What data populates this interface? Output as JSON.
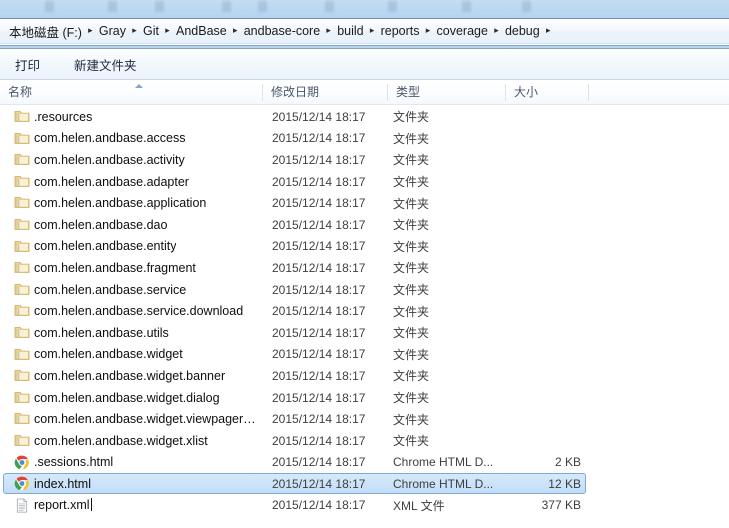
{
  "window": {
    "top_strip_label": ""
  },
  "addressbar": {
    "crumbs": [
      {
        "label": "本地磁盘 (F:)"
      },
      {
        "label": "Gray"
      },
      {
        "label": "Git"
      },
      {
        "label": "AndBase"
      },
      {
        "label": "andbase-core"
      },
      {
        "label": "build"
      },
      {
        "label": "reports"
      },
      {
        "label": "coverage"
      },
      {
        "label": "debug"
      }
    ],
    "separator": "▸"
  },
  "toolbar": {
    "print_label": "打印",
    "new_folder_label": "新建文件夹"
  },
  "columns": {
    "name": "名称",
    "date_modified": "修改日期",
    "type": "类型",
    "size": "大小",
    "sort_column": "名称",
    "sort_direction": "ascending"
  },
  "colors": {
    "accent": "#b8d5f0",
    "selection_fill": "#cce3fa",
    "selection_border": "#7fa9d6",
    "folder_icon": "#f6d98a",
    "header_text": "#4a586b"
  },
  "files": [
    {
      "name": ".resources",
      "date": "2015/12/14 18:17",
      "type": "文件夹",
      "size": "",
      "icon": "folder-icon",
      "selected": false
    },
    {
      "name": "com.helen.andbase.access",
      "date": "2015/12/14 18:17",
      "type": "文件夹",
      "size": "",
      "icon": "folder-icon",
      "selected": false
    },
    {
      "name": "com.helen.andbase.activity",
      "date": "2015/12/14 18:17",
      "type": "文件夹",
      "size": "",
      "icon": "folder-icon",
      "selected": false
    },
    {
      "name": "com.helen.andbase.adapter",
      "date": "2015/12/14 18:17",
      "type": "文件夹",
      "size": "",
      "icon": "folder-icon",
      "selected": false
    },
    {
      "name": "com.helen.andbase.application",
      "date": "2015/12/14 18:17",
      "type": "文件夹",
      "size": "",
      "icon": "folder-icon",
      "selected": false
    },
    {
      "name": "com.helen.andbase.dao",
      "date": "2015/12/14 18:17",
      "type": "文件夹",
      "size": "",
      "icon": "folder-icon",
      "selected": false
    },
    {
      "name": "com.helen.andbase.entity",
      "date": "2015/12/14 18:17",
      "type": "文件夹",
      "size": "",
      "icon": "folder-icon",
      "selected": false
    },
    {
      "name": "com.helen.andbase.fragment",
      "date": "2015/12/14 18:17",
      "type": "文件夹",
      "size": "",
      "icon": "folder-icon",
      "selected": false
    },
    {
      "name": "com.helen.andbase.service",
      "date": "2015/12/14 18:17",
      "type": "文件夹",
      "size": "",
      "icon": "folder-icon",
      "selected": false
    },
    {
      "name": "com.helen.andbase.service.download",
      "date": "2015/12/14 18:17",
      "type": "文件夹",
      "size": "",
      "icon": "folder-icon",
      "selected": false
    },
    {
      "name": "com.helen.andbase.utils",
      "date": "2015/12/14 18:17",
      "type": "文件夹",
      "size": "",
      "icon": "folder-icon",
      "selected": false
    },
    {
      "name": "com.helen.andbase.widget",
      "date": "2015/12/14 18:17",
      "type": "文件夹",
      "size": "",
      "icon": "folder-icon",
      "selected": false
    },
    {
      "name": "com.helen.andbase.widget.banner",
      "date": "2015/12/14 18:17",
      "type": "文件夹",
      "size": "",
      "icon": "folder-icon",
      "selected": false
    },
    {
      "name": "com.helen.andbase.widget.dialog",
      "date": "2015/12/14 18:17",
      "type": "文件夹",
      "size": "",
      "icon": "folder-icon",
      "selected": false
    },
    {
      "name": "com.helen.andbase.widget.viewpager…",
      "date": "2015/12/14 18:17",
      "type": "文件夹",
      "size": "",
      "icon": "folder-icon",
      "selected": false
    },
    {
      "name": "com.helen.andbase.widget.xlist",
      "date": "2015/12/14 18:17",
      "type": "文件夹",
      "size": "",
      "icon": "folder-icon",
      "selected": false
    },
    {
      "name": ".sessions.html",
      "date": "2015/12/14 18:17",
      "type": "Chrome HTML D...",
      "size": "2 KB",
      "icon": "chrome-icon",
      "selected": false
    },
    {
      "name": "index.html",
      "date": "2015/12/14 18:17",
      "type": "Chrome HTML D...",
      "size": "12 KB",
      "icon": "chrome-icon",
      "selected": true
    },
    {
      "name": "report.xml",
      "date": "2015/12/14 18:17",
      "type": "XML 文件",
      "size": "377 KB",
      "icon": "xml-file-icon",
      "selected": false
    }
  ]
}
